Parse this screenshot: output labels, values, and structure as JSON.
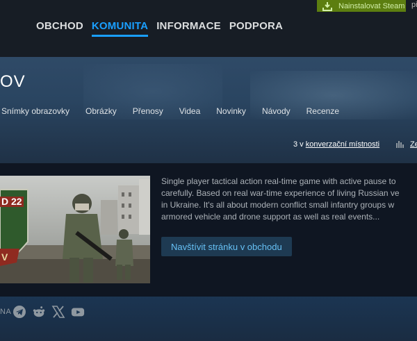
{
  "header": {
    "install_label": "Nainstalovat Steam",
    "login_text": "přihlásit se",
    "nav": [
      {
        "label": "OBCHOD",
        "active": false
      },
      {
        "label": "KOMUNITA",
        "active": true
      },
      {
        "label": "INFORMACE",
        "active": false
      },
      {
        "label": "PODPORA",
        "active": false
      }
    ]
  },
  "hub": {
    "title_fragment": "OV",
    "tabs": [
      "Snímky obrazovky",
      "Obrázky",
      "Přenosy",
      "Videa",
      "Novinky",
      "Návody",
      "Recenze"
    ],
    "chat_count": "3 v",
    "chat_link": "konverzační místnosti",
    "stats_text": "Ze"
  },
  "game": {
    "capsule_text_top": "D 22",
    "capsule_text_bottom": "V",
    "description_lines": [
      "Single player tactical action real-time game with active pause to",
      "carefully. Based on real war-time experience of living Russian ve",
      "in Ukraine. It's all about modern conflict small infantry groups w",
      "armored vehicle and drone support as well as real events..."
    ],
    "store_button": "Navštívit stránku v obchodu"
  },
  "footer": {
    "follow_label": "NA",
    "social_icons": [
      "telegram-icon",
      "reddit-icon",
      "x-icon",
      "youtube-icon"
    ]
  },
  "colors": {
    "install_bg": "#5c7e10",
    "accent_blue": "#1a9fff",
    "store_link": "#66c0f4"
  }
}
